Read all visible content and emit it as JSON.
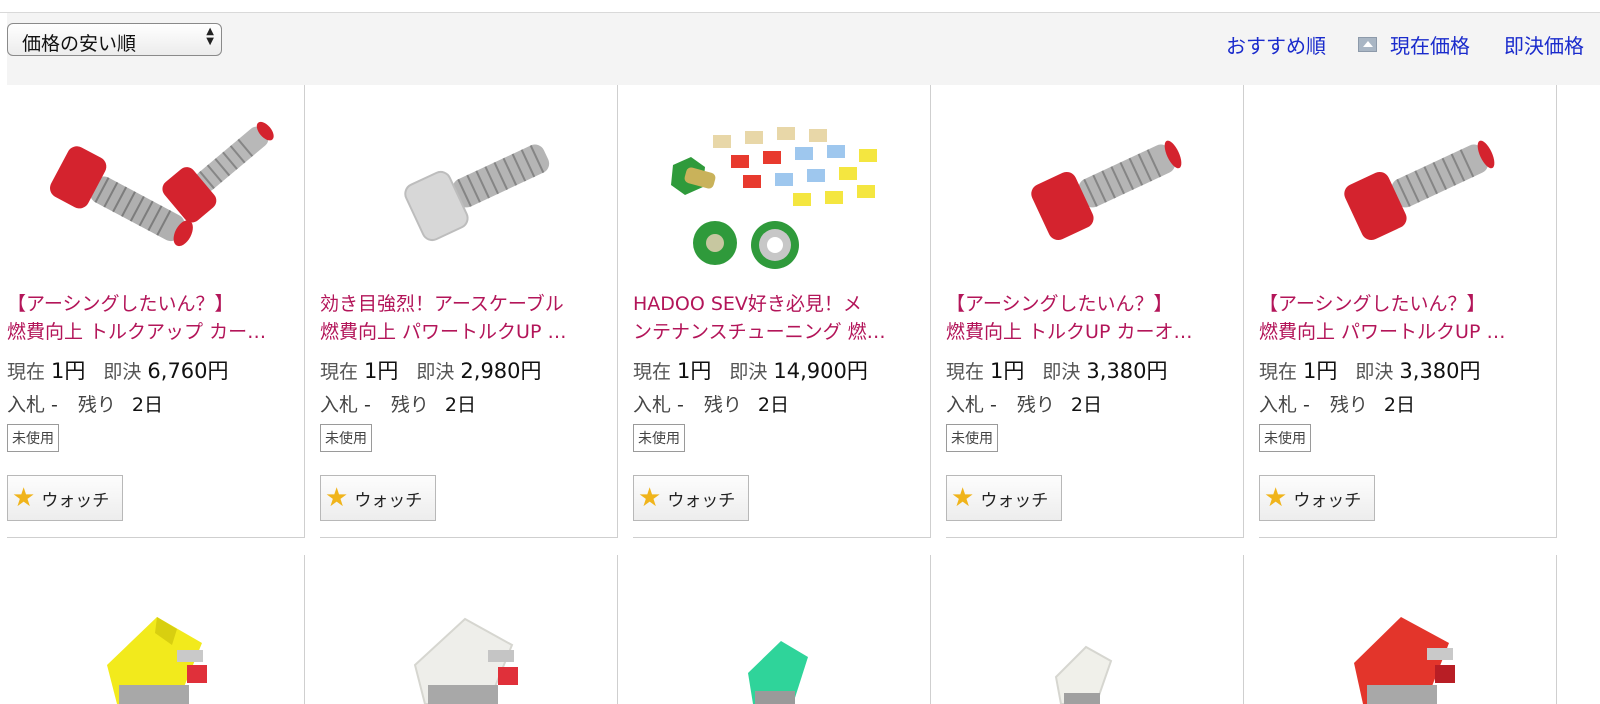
{
  "sort": {
    "select_value": "価格の安い順",
    "links": {
      "recommended": "おすすめ順",
      "current_price": "現在価格",
      "buyout_price": "即決価格"
    }
  },
  "labels": {
    "current": "現在",
    "buyout": "即決",
    "bids": "入札",
    "remaining": "残り",
    "condition": "未使用",
    "watch": "ウォッチ"
  },
  "items": [
    {
      "title_line1": "【アーシングしたいん？】",
      "title_line2": "燃費向上 トルクアップ カー…",
      "current": "1円",
      "buyout": "6,760円",
      "bids": "-",
      "remaining": "2日",
      "thumb": "red-bolts-pair"
    },
    {
      "title_line1": "効き目強烈！アースケーブル",
      "title_line2": "燃費向上 パワートルクUP …",
      "current": "1円",
      "buyout": "2,980円",
      "bids": "-",
      "remaining": "2日",
      "thumb": "silver-bolt"
    },
    {
      "title_line1": "HADOO SEV好き必見！メ",
      "title_line2": "ンテナンスチューニング 燃…",
      "current": "1円",
      "buyout": "14,900円",
      "bids": "-",
      "remaining": "2日",
      "thumb": "fuses-and-nuts"
    },
    {
      "title_line1": "【アーシングしたいん？】",
      "title_line2": "燃費向上 トルクUP カーオ…",
      "current": "1円",
      "buyout": "3,380円",
      "bids": "-",
      "remaining": "2日",
      "thumb": "red-bolt"
    },
    {
      "title_line1": "【アーシングしたいん？】",
      "title_line2": "燃費向上 パワートルクUP …",
      "current": "1円",
      "buyout": "3,380円",
      "bids": "-",
      "remaining": "2日",
      "thumb": "red-bolt"
    }
  ],
  "row2_thumbs": [
    "yellow-fuse",
    "white-fuse",
    "green-fuse",
    "small-white-fuse",
    "red-fuse"
  ],
  "colors": {
    "title": "#b31559",
    "link": "#1a2bcc",
    "star": "#f0b41b"
  }
}
